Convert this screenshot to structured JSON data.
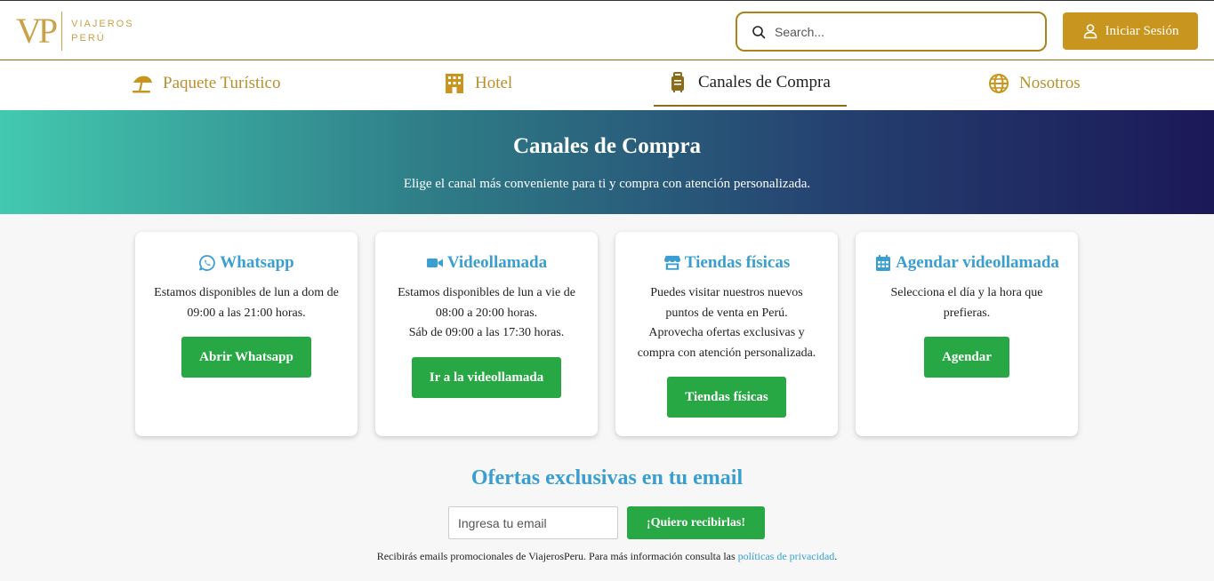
{
  "header": {
    "logo_mark": "VP",
    "logo_line1": "VIAJEROS",
    "logo_line2": "PERÚ",
    "search_placeholder": "Search...",
    "login_label": "Iniciar Sesión"
  },
  "nav": {
    "items": [
      {
        "label": "Paquete Turístico",
        "icon": "beach-umbrella-icon"
      },
      {
        "label": "Hotel",
        "icon": "hotel-building-icon"
      },
      {
        "label": "Canales de Compra",
        "icon": "suitcase-icon",
        "active": true
      },
      {
        "label": "Nosotros",
        "icon": "globe-icon"
      }
    ]
  },
  "hero": {
    "title": "Canales de Compra",
    "subtitle": "Elige el canal más conveniente para ti y compra con atención personalizada."
  },
  "cards": [
    {
      "title": "Whatsapp",
      "icon": "whatsapp-icon",
      "lines": [
        "Estamos disponibles de lun a dom de",
        "09:00 a las 21:00 horas."
      ],
      "button": "Abrir Whatsapp"
    },
    {
      "title": "Videollamada",
      "icon": "video-camera-icon",
      "lines": [
        "Estamos disponibles de lun a vie de",
        "08:00 a 20:00 horas.",
        "Sáb de 09:00 a las 17:30 horas."
      ],
      "button": "Ir a la videollamada"
    },
    {
      "title": "Tiendas físicas",
      "icon": "store-icon",
      "lines": [
        "Puedes visitar nuestros nuevos",
        "puntos de venta en Perú.",
        "Aprovecha ofertas exclusivas y",
        "compra con atención personalizada."
      ],
      "button": "Tiendas físicas"
    },
    {
      "title": "Agendar videollamada",
      "icon": "calendar-icon",
      "lines": [
        "Selecciona el día y la hora que",
        "prefieras."
      ],
      "button": "Agendar"
    }
  ],
  "newsletter": {
    "title": "Ofertas exclusivas en tu email",
    "input_placeholder": "Ingresa tu email",
    "button": "¡Quiero recibirlas!",
    "note_prefix": "Recibirás emails promocionales de ViajerosPeru. Para más información consulta las ",
    "note_link": "políticas de privacidad",
    "note_suffix": "."
  },
  "colors": {
    "brand_gold": "#c8961e",
    "accent_blue": "#3a9fd0",
    "button_green": "#28a745"
  }
}
